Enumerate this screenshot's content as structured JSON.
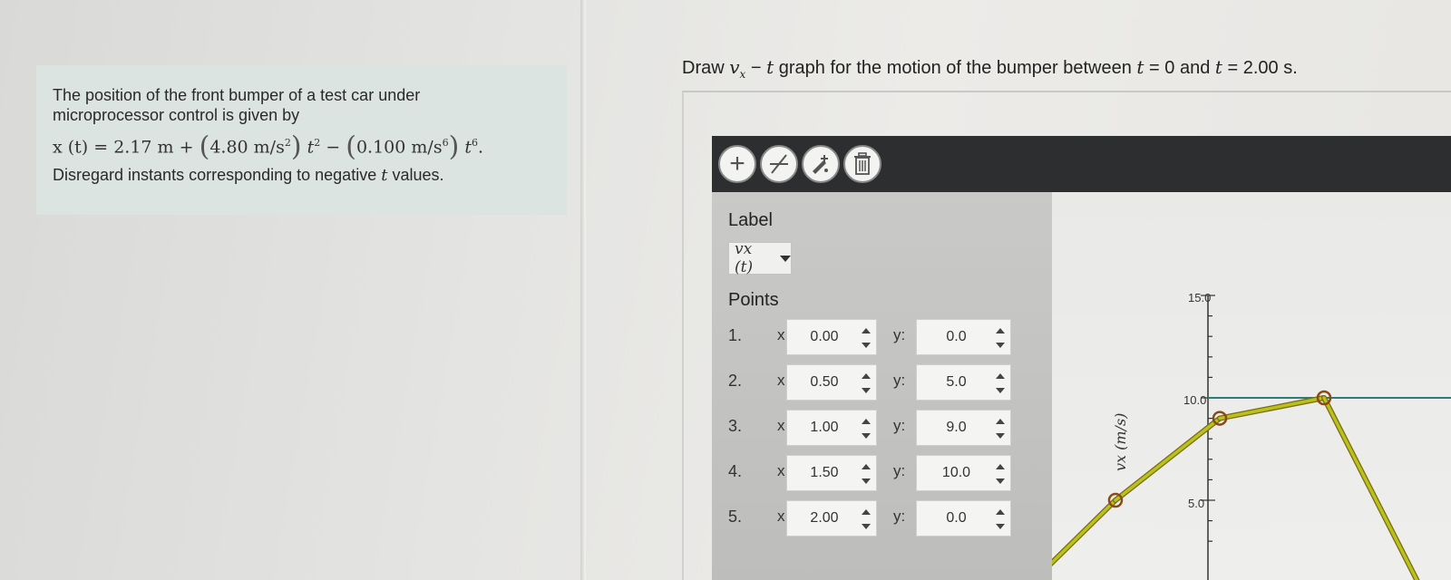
{
  "problem": {
    "line1": "The position of the front bumper of a test car under",
    "line2": "microprocessor control is given by",
    "eq_lhs": "x (t) = 2.17 m +",
    "coef1": "4.80 m/s",
    "exp1": "2",
    "t1": "t",
    "texp1": "2",
    "minus": "−",
    "coef2": "0.100 m/s",
    "exp2": "6",
    "t2": "t",
    "texp2": "6",
    "line4_a": "Disregard instants corresponding to negative ",
    "line4_t": "t",
    "line4_b": " values."
  },
  "question": {
    "a": "Draw ",
    "vx": "v",
    "vx_sub": "x",
    "b": " − ",
    "t": "t",
    "c": " graph for the motion of the bumper between ",
    "t0": "t",
    "d": " = 0 and ",
    "t1": "t",
    "e": " = 2.00 s."
  },
  "toolbar": {
    "icons": [
      "plus-icon",
      "no-line-icon",
      "edit-point-icon",
      "trash-icon"
    ],
    "plus_glyph": "+",
    "trash_glyph": "🗑"
  },
  "panel": {
    "label_heading": "Label",
    "label_value": "vx (t)",
    "points_heading": "Points",
    "x_label": "x:",
    "y_label": "y:",
    "points": [
      {
        "n": "1.",
        "x": "0.00",
        "y": "0.0"
      },
      {
        "n": "2.",
        "x": "0.50",
        "y": "5.0"
      },
      {
        "n": "3.",
        "x": "1.00",
        "y": "9.0"
      },
      {
        "n": "4.",
        "x": "1.50",
        "y": "10.0"
      },
      {
        "n": "5.",
        "x": "2.00",
        "y": "0.0"
      }
    ]
  },
  "graph": {
    "y_axis_label": "vx (m/s)",
    "y_ticks": [
      "15.0",
      "10.0",
      "5.0"
    ],
    "colors": {
      "series": "#b8c21a",
      "series_edge": "#7a6a16",
      "guide_line": "#2c7a7a"
    }
  },
  "chart_data": {
    "type": "line",
    "ylabel": "vx (m/s)",
    "yticks": [
      5.0,
      10.0,
      15.0
    ],
    "series": [
      {
        "values": [
          {
            "x": 0.0,
            "y": 0.0
          },
          {
            "x": 0.5,
            "y": 5.0
          },
          {
            "x": 1.0,
            "y": 9.0
          },
          {
            "x": 1.5,
            "y": 10.0
          },
          {
            "x": 2.0,
            "y": 0.0
          }
        ]
      }
    ]
  }
}
